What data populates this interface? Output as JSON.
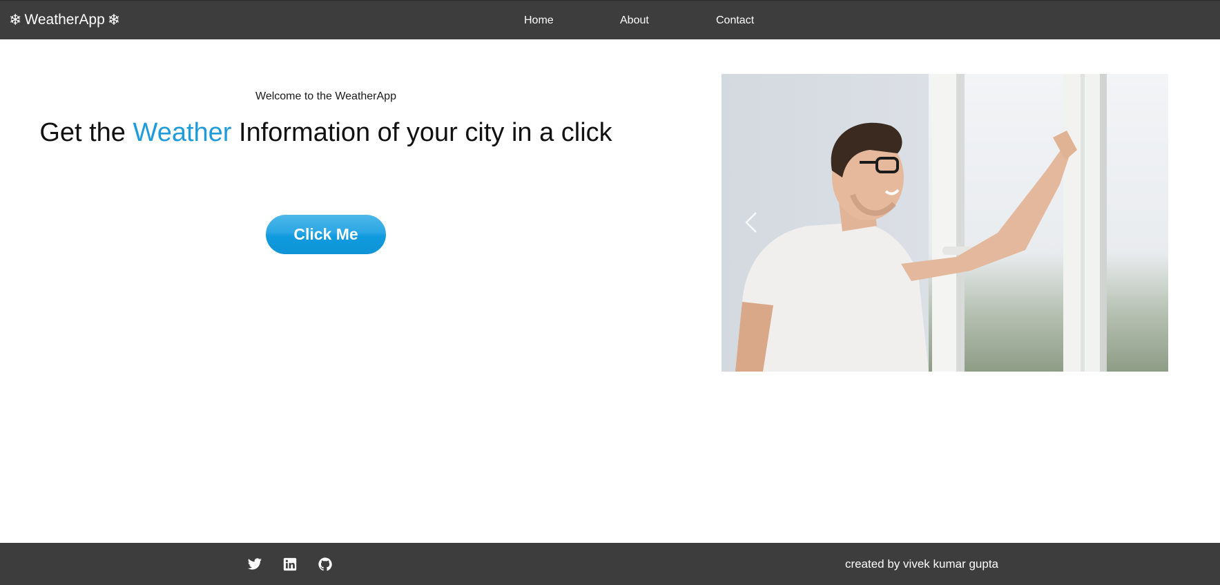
{
  "navbar": {
    "brand_icon_left": "❄",
    "brand_label": "WeatherApp",
    "brand_icon_right": "❄",
    "links": [
      {
        "label": "Home"
      },
      {
        "label": "About"
      },
      {
        "label": "Contact"
      }
    ],
    "background": "#3d3d3d"
  },
  "hero": {
    "welcome": "Welcome to the WeatherApp",
    "headline_before": "Get the ",
    "headline_accent": "Weather",
    "headline_after": " Information of your city in a click",
    "accent_color": "#1e9bdc",
    "cta_label": "Click Me"
  },
  "carousel": {
    "image_alt": "man-looking-out-window-photo",
    "prev_icon": "chevron-left-icon"
  },
  "footer": {
    "social_icons": [
      "twitter-icon",
      "linkedin-icon",
      "github-icon"
    ],
    "credit": "created by vivek kumar gupta"
  }
}
